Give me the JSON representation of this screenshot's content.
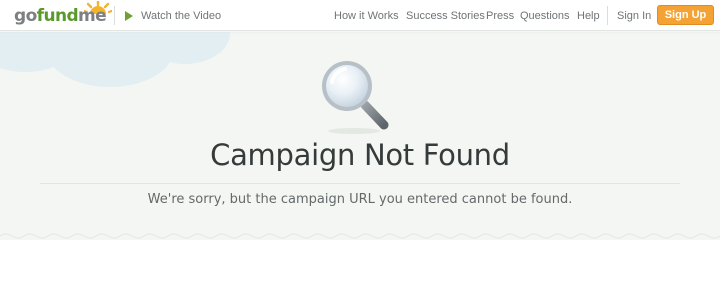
{
  "header": {
    "logo": {
      "go": "go",
      "fund": "fund",
      "me": "me"
    },
    "watch_video_label": "Watch the Video",
    "nav": {
      "how_it_works": "How it Works",
      "success_stories": "Success Stories",
      "press": "Press",
      "questions": "Questions",
      "help": "Help",
      "sign_in": "Sign In",
      "sign_up": "Sign Up"
    }
  },
  "main": {
    "title": "Campaign Not Found",
    "message": "We're sorry, but the campaign URL you entered cannot be found."
  },
  "colors": {
    "brand_green": "#5a9a2c",
    "accent_orange": "#f3a233",
    "hero_background": "#f3f6f2",
    "text_dark": "#353a3b"
  },
  "icons": [
    "sun-logo-icon",
    "play-icon",
    "magnifier-icon"
  ]
}
